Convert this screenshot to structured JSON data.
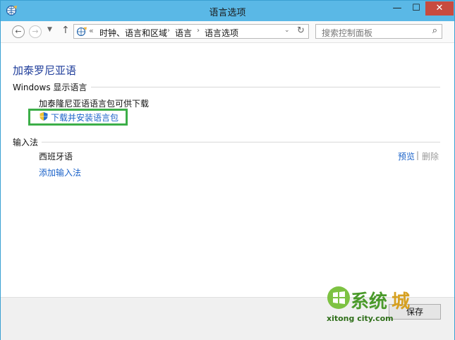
{
  "window": {
    "title": "语言选项",
    "min_glyph": "—",
    "max_glyph": "☐",
    "close_glyph": "✕"
  },
  "toolbar": {
    "back_glyph": "←",
    "forward_glyph": "→",
    "recent_glyph": "▼",
    "up_glyph": "↑",
    "address_prefix": "«",
    "breadcrumbs": [
      "时钟、语言和区域",
      "语言",
      "语言选项"
    ],
    "breadcrumb_separator": "›",
    "address_dropdown_glyph": "⌄",
    "refresh_glyph": "↻",
    "search_placeholder": "搜索控制面板",
    "search_glyph": "⌕"
  },
  "main": {
    "language_title": "加泰罗尼亚语",
    "display_section": {
      "title": "Windows 显示语言",
      "status": "加泰隆尼亚语语言包可供下载",
      "download_link": "下载并安装语言包"
    },
    "input_section": {
      "title": "输入法",
      "method_name": "西班牙语",
      "preview_link": "预览",
      "separator": "|",
      "remove_link": "删除",
      "add_link": "添加输入法"
    }
  },
  "footer": {
    "save_label": "保存"
  },
  "watermark": {
    "brand": "系统",
    "brand_suffix": "城",
    "url": "xitong city.com"
  },
  "colors": {
    "titlebar": "#5ab8e6",
    "link": "#1c63c9",
    "heading": "#1e3c9a",
    "highlight_box": "#3cae48",
    "close_button": "#c74b3f"
  },
  "icons": {
    "title": "control-panel-language-icon",
    "address": "control-panel-language-icon",
    "download": "uac-shield-icon"
  }
}
